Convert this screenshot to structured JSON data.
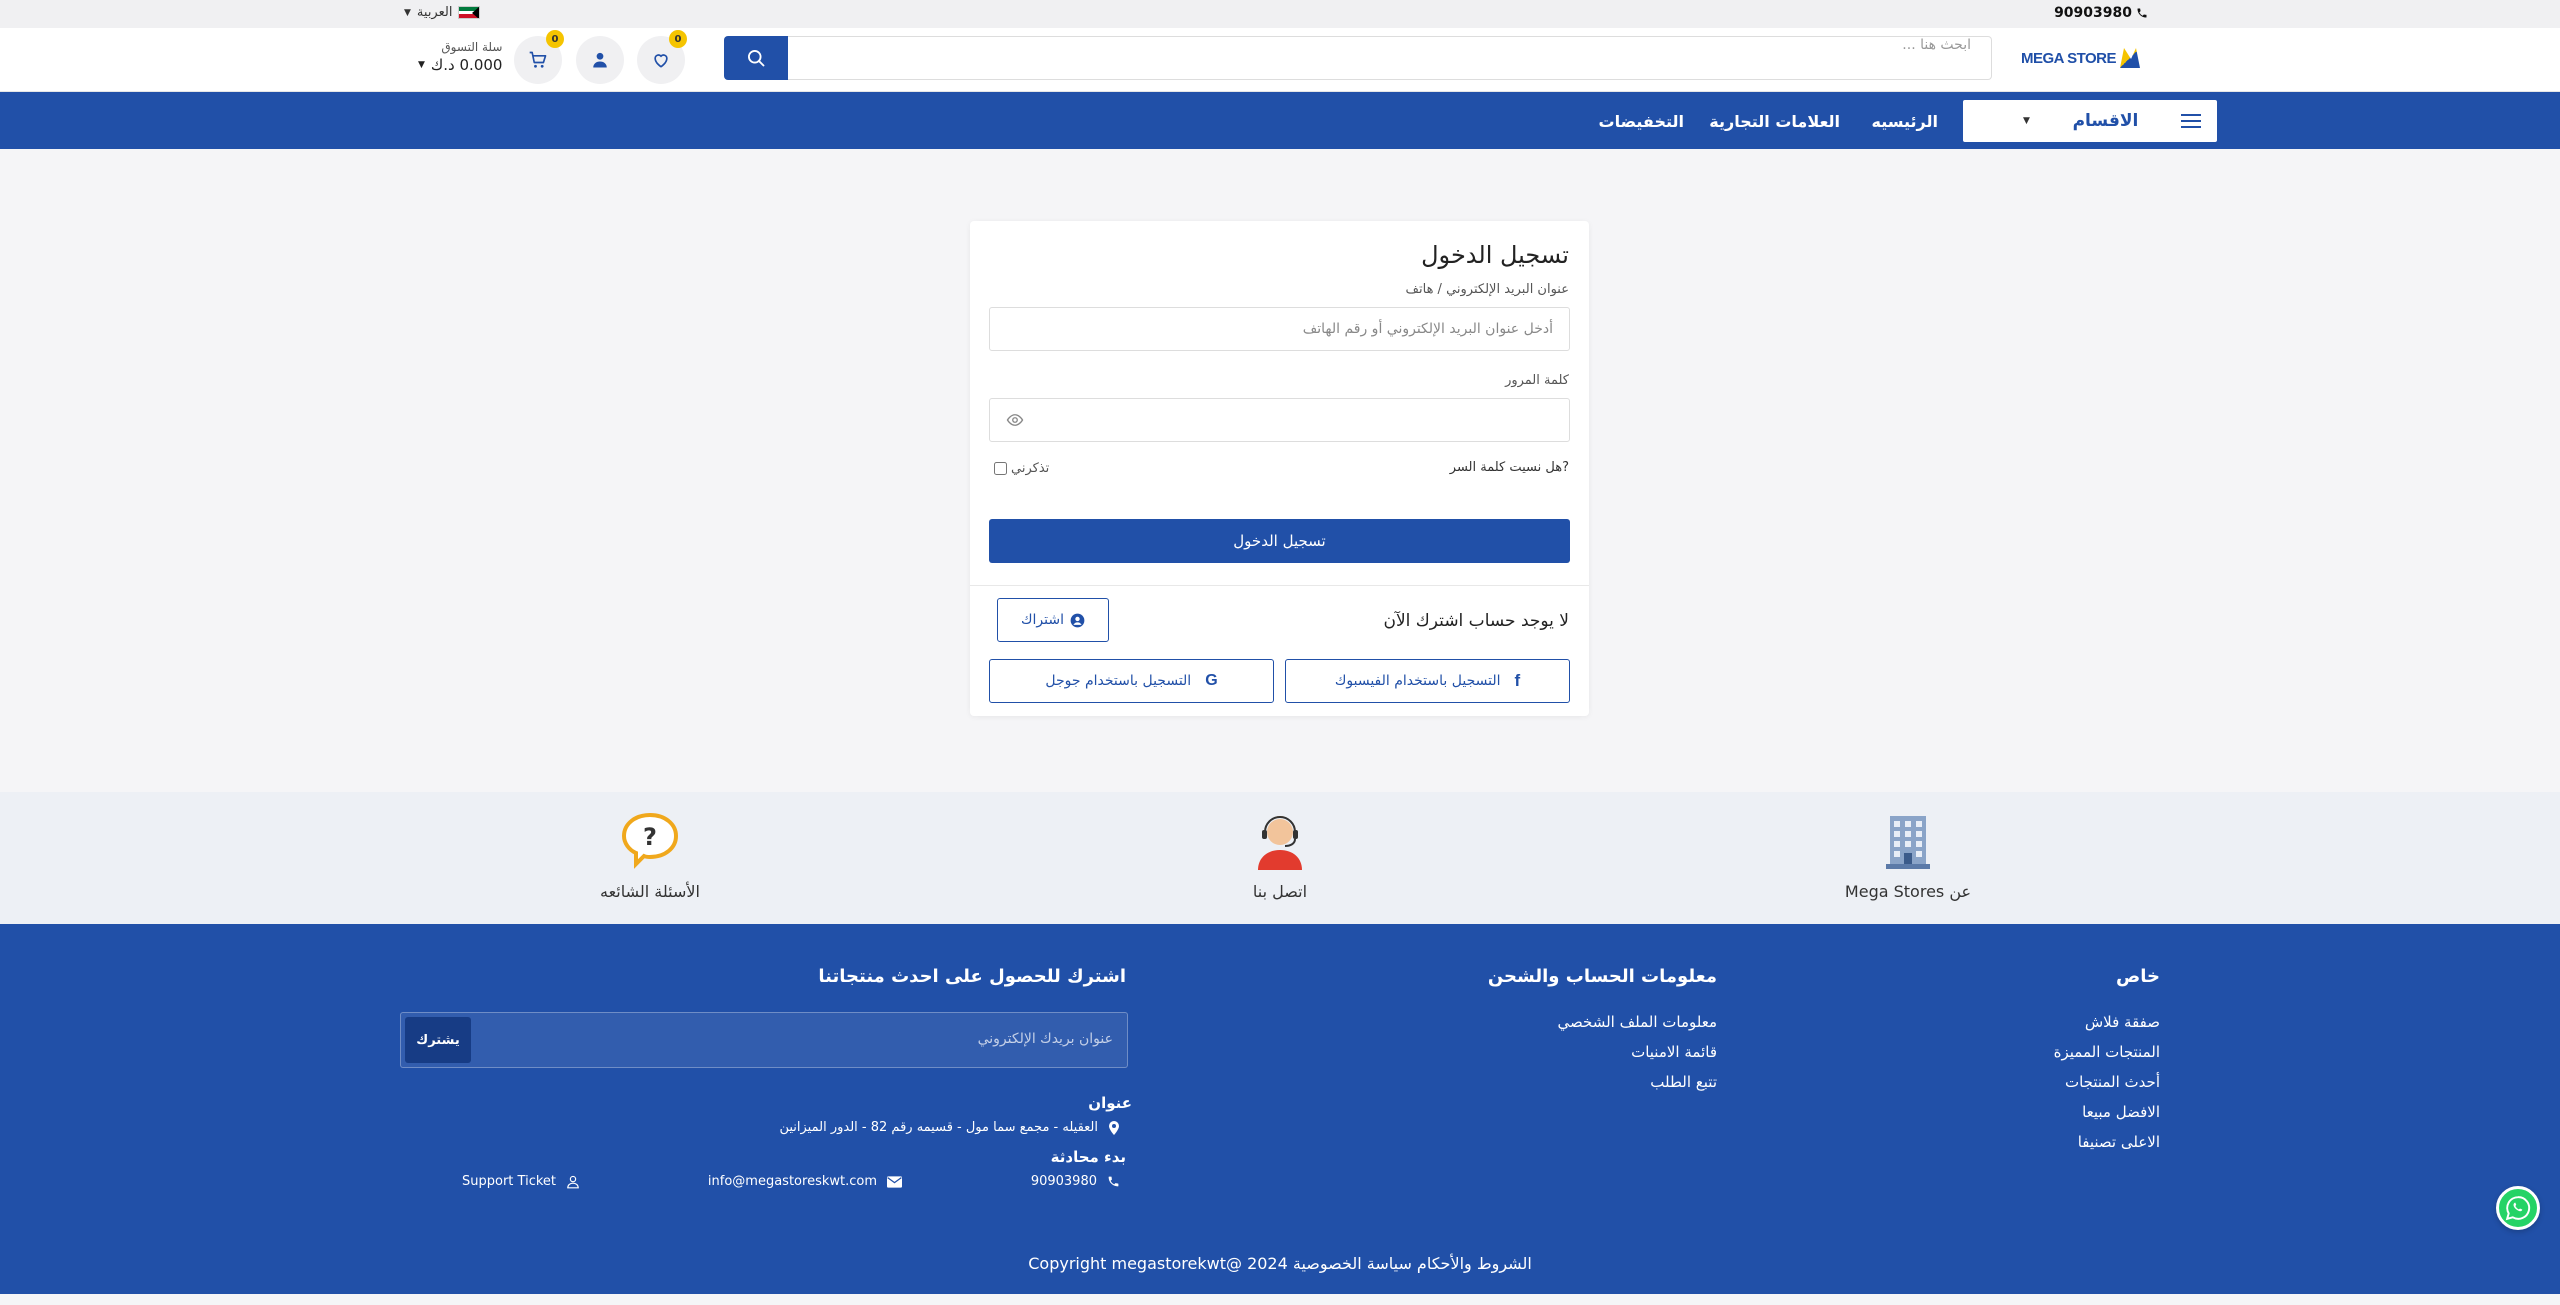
{
  "topbar": {
    "phone": "90903980",
    "language": "العربية"
  },
  "header": {
    "logo_text": "MEGA STORE",
    "search_placeholder": "ابحث هنا ...",
    "wishlist_count": "0",
    "cart_count": "0",
    "cart_label": "سلة التسوق",
    "cart_total": "0.000 د.ك"
  },
  "nav": {
    "categories_label": "الاقسام",
    "links": [
      "الرئيسيه",
      "العلامات التجارية",
      "التخفيضات"
    ]
  },
  "login": {
    "title": "تسجيل الدخول",
    "email_label": "عنوان البريد الإلكتروني / هاتف",
    "email_placeholder": "أدخل عنوان البريد الإلكتروني أو رقم الهاتف",
    "password_label": "كلمة المرور",
    "forgot": "?هل نسيت كلمة السر",
    "remember": "تذكرني",
    "submit": "تسجيل الدخول",
    "no_account": "لا يوجد حساب اشترك الآن",
    "signup": "اشتراك",
    "facebook": "التسجيل باستخدام الفيسبوك",
    "google": "التسجيل باستخدام جوجل"
  },
  "info": {
    "about": "عن Mega Stores",
    "contact": "اتصل بنا",
    "faq": "الأسئلة الشائعه"
  },
  "footer": {
    "col1_title": "خاص",
    "col1_links": [
      "صفقة فلاش",
      "المنتجات المميزة",
      "أحدث المنتجات",
      "الافضل مبيعا",
      "الاعلى تصنيفا"
    ],
    "col2_title": "معلومات الحساب والشحن",
    "col2_links": [
      "معلومات الملف الشخصي",
      "قائمة الامنيات",
      "تتبع الطلب"
    ],
    "newsletter_title": "اشترك للحصول على احدث منتجاتنا",
    "newsletter_placeholder": "عنوان بريدك الإلكتروني",
    "newsletter_button": "يشترك",
    "address_title": "عنوان",
    "address": "العقيله - مجمع سما مول - قسيمه رقم 82 - الدور الميزانين",
    "chat_title": "بدء محادثة",
    "phone": "90903980",
    "email": "info@megastoreskwt.com",
    "support": "Support Ticket",
    "copyright": "الشروط والأحكام سياسة الخصوصية  Copyright megastorekwt@ 2024",
    "colors": {
      "primary": "#2150a8",
      "accent": "#f5c400"
    }
  }
}
